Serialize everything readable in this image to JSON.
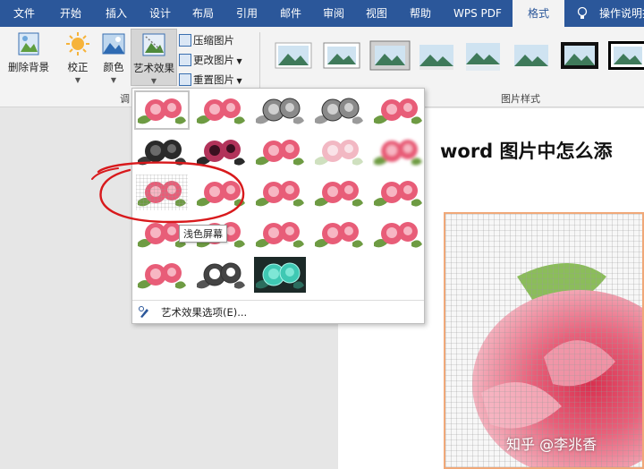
{
  "tabs": {
    "file": "文件",
    "home": "开始",
    "insert": "插入",
    "design": "设计",
    "layout": "布局",
    "references": "引用",
    "mailings": "邮件",
    "review": "审阅",
    "view": "视图",
    "help": "帮助",
    "wps_pdf": "WPS PDF",
    "format": "格式",
    "tell_me": "操作说明搜"
  },
  "ribbon": {
    "remove_background": "删除背景",
    "corrections": "校正",
    "color": "颜色",
    "artistic_effects": "艺术效果",
    "compress_pictures": "压缩图片",
    "change_picture": "更改图片",
    "reset_picture": "重置图片",
    "adjust_group_label": "调",
    "picture_styles_label": "图片样式"
  },
  "gallery": {
    "tooltip": "浅色屏幕",
    "options_label": "艺术效果选项(E)..."
  },
  "document": {
    "heading": "word 图片中怎么添"
  },
  "watermark": "知乎 @李兆香",
  "colors": {
    "accent": "#2b579a",
    "annotation": "#d8191c",
    "rose": "#e8607a",
    "leaf": "#6e9b43"
  }
}
